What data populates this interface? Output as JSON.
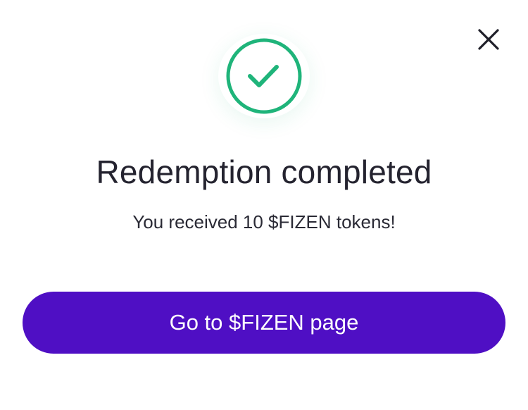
{
  "dialog": {
    "title": "Redemption completed",
    "message": "You received 10 $FIZEN tokens!",
    "primary_button_label": "Go to $FIZEN page",
    "close_icon": "close-icon",
    "status_icon": "checkmark-circle-icon"
  },
  "colors": {
    "success": "#1fb47a",
    "primary": "#4f0fc4",
    "text": "#24232f"
  }
}
